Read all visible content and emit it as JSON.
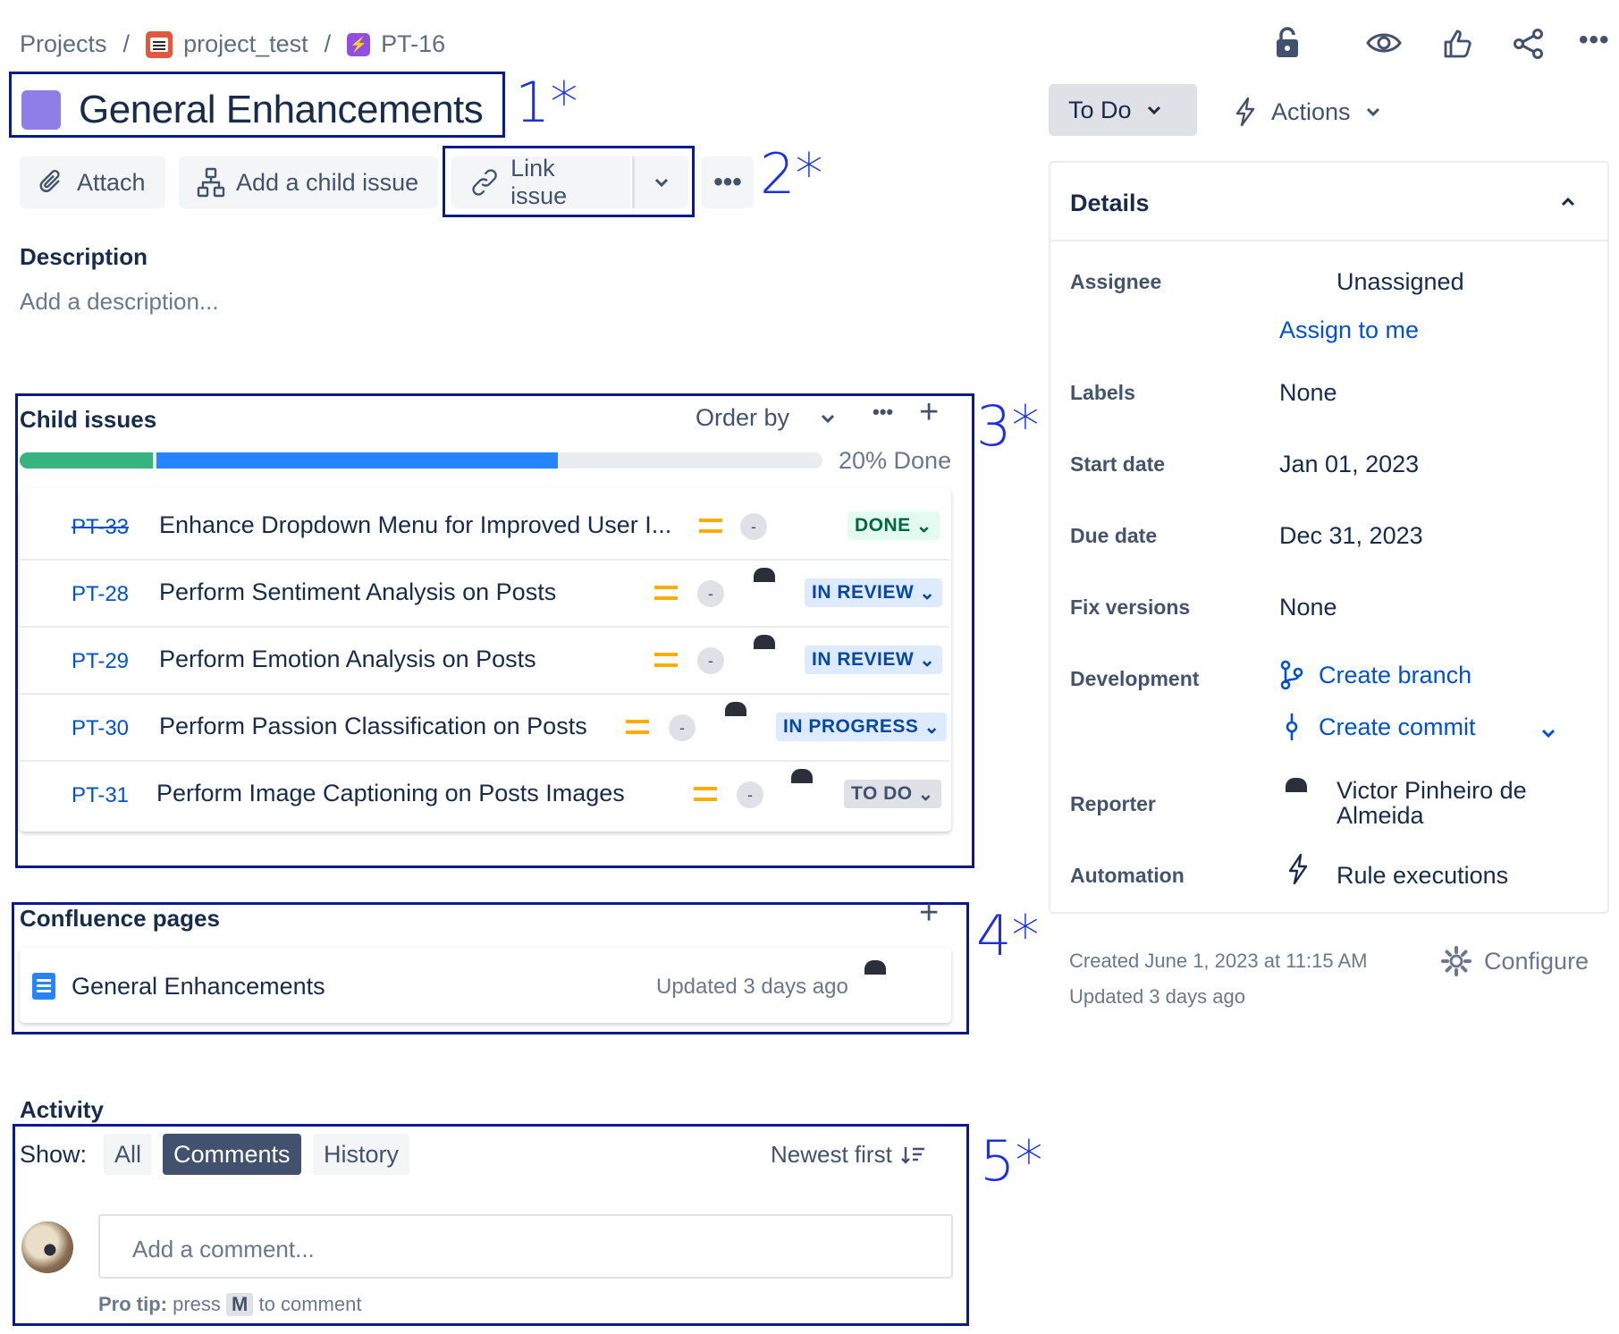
{
  "breadcrumb": {
    "projects": "Projects",
    "separator": "/",
    "project": "project_test",
    "issue_key": "PT-16"
  },
  "issue": {
    "title": "General Enhancements",
    "epic_color": "#8f7ee7"
  },
  "toolbar": {
    "attach": "Attach",
    "add_child": "Add a child issue",
    "link_issue": "Link issue",
    "more": "•••"
  },
  "description": {
    "heading": "Description",
    "placeholder": "Add a description..."
  },
  "child_issues": {
    "heading": "Child issues",
    "order_by": "Order by",
    "more": "•••",
    "add": "+",
    "progress_text": "20% Done",
    "progress": {
      "done": 0.166,
      "in_progress": 0.5
    },
    "items": [
      {
        "key": "PT-33",
        "summary": "Enhance Dropdown Menu for Improved User I...",
        "status": "DONE",
        "strikethrough": true,
        "assignee": "unassigned"
      },
      {
        "key": "PT-28",
        "summary": "Perform Sentiment Analysis on Posts",
        "status": "IN REVIEW",
        "strikethrough": false,
        "assignee": "user"
      },
      {
        "key": "PT-29",
        "summary": "Perform Emotion Analysis on Posts",
        "status": "IN REVIEW",
        "strikethrough": false,
        "assignee": "user"
      },
      {
        "key": "PT-30",
        "summary": "Perform Passion Classification on Posts",
        "status": "IN PROGRESS",
        "strikethrough": false,
        "assignee": "user"
      },
      {
        "key": "PT-31",
        "summary": "Perform Image Captioning on Posts Images",
        "status": "TO DO",
        "strikethrough": false,
        "assignee": "user"
      }
    ],
    "priority_dash": "-"
  },
  "confluence": {
    "heading": "Confluence pages",
    "add": "+",
    "page_title": "General Enhancements",
    "updated": "Updated 3 days ago"
  },
  "activity": {
    "heading": "Activity",
    "show_label": "Show:",
    "tabs": [
      "All",
      "Comments",
      "History"
    ],
    "active_tab": "Comments",
    "sort": "Newest first",
    "comment_placeholder": "Add a comment...",
    "pro_tip_bold": "Pro tip:",
    "pro_tip_press": "press",
    "pro_tip_key": "M",
    "pro_tip_rest": "to comment"
  },
  "right": {
    "status": "To Do",
    "actions": "Actions",
    "details_heading": "Details",
    "fields": {
      "assignee_label": "Assignee",
      "assignee_value": "Unassigned",
      "assign_to_me": "Assign to me",
      "labels_label": "Labels",
      "labels_value": "None",
      "start_label": "Start date",
      "start_value": "Jan 01, 2023",
      "due_label": "Due date",
      "due_value": "Dec 31, 2023",
      "fix_label": "Fix versions",
      "fix_value": "None",
      "dev_label": "Development",
      "create_branch": "Create branch",
      "create_commit": "Create commit",
      "reporter_label": "Reporter",
      "reporter_line1": "Victor Pinheiro de",
      "reporter_line2": "Almeida",
      "automation_label": "Automation",
      "automation_value": "Rule executions"
    },
    "created": "Created June 1, 2023 at 11:15 AM",
    "updated": "Updated 3 days ago",
    "configure": "Configure"
  },
  "annotations": [
    "1*",
    "2*",
    "3*",
    "4*",
    "5*"
  ],
  "colors": {
    "done": "#36b37e",
    "in_progress": "#2684ff",
    "annotation_box": "#0a1a8a",
    "annotation_text": "#1b30e0",
    "link": "#0052cc",
    "priority_medium": "#ffab00"
  }
}
